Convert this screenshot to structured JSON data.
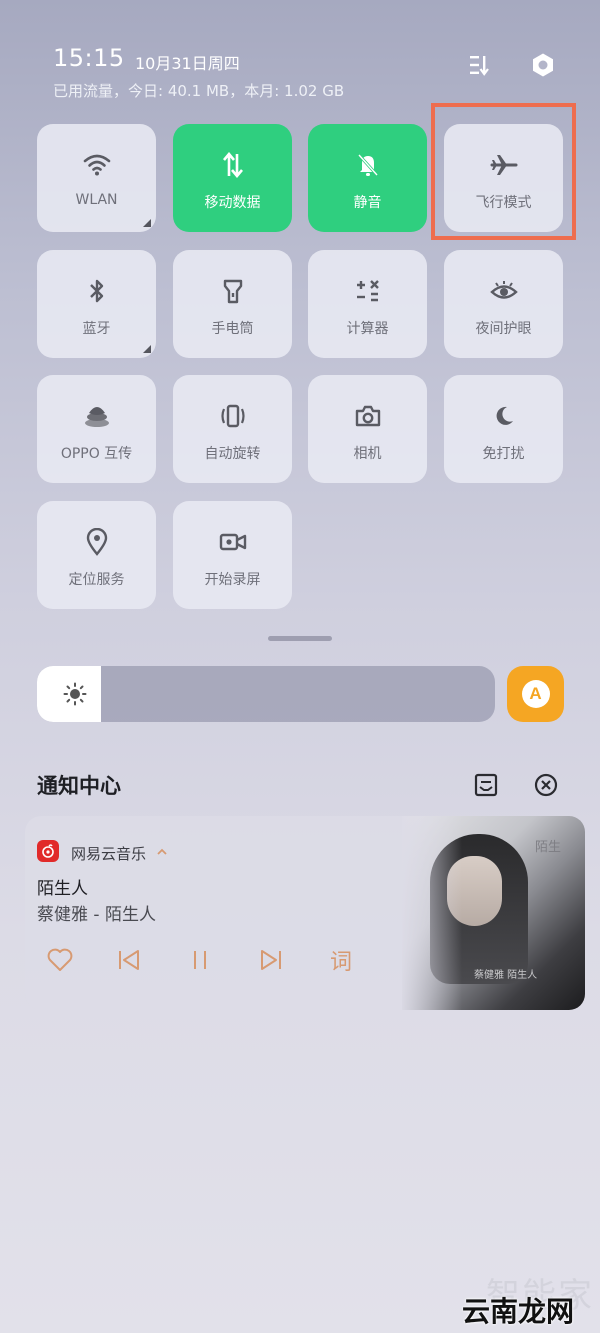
{
  "status": {
    "time": "15:15",
    "date": "10月31日周四",
    "data_usage": "已用流量，今日: 40.1 MB，本月: 1.02 GB"
  },
  "tiles": [
    {
      "label": "WLAN",
      "icon": "wifi-icon",
      "active": false
    },
    {
      "label": "移动数据",
      "icon": "mobile-data-icon",
      "active": true
    },
    {
      "label": "静音",
      "icon": "silent-bell-icon",
      "active": true
    },
    {
      "label": "飞行模式",
      "icon": "airplane-icon",
      "active": false
    },
    {
      "label": "蓝牙",
      "icon": "bluetooth-icon",
      "active": false
    },
    {
      "label": "手电筒",
      "icon": "flashlight-icon",
      "active": false
    },
    {
      "label": "计算器",
      "icon": "calculator-icon",
      "active": false
    },
    {
      "label": "夜间护眼",
      "icon": "eye-icon",
      "active": false
    },
    {
      "label": "OPPO 互传",
      "icon": "oppo-share-icon",
      "active": false
    },
    {
      "label": "自动旋转",
      "icon": "auto-rotate-icon",
      "active": false
    },
    {
      "label": "相机",
      "icon": "camera-icon",
      "active": false
    },
    {
      "label": "免打扰",
      "icon": "moon-icon",
      "active": false
    },
    {
      "label": "定位服务",
      "icon": "location-icon",
      "active": false
    },
    {
      "label": "开始录屏",
      "icon": "screen-record-icon",
      "active": false
    }
  ],
  "brightness": {
    "level": 0.14
  },
  "auto_brightness": {
    "label": "A"
  },
  "notifications": {
    "title": "通知中心"
  },
  "music": {
    "app_name": "网易云音乐",
    "song": "陌生人",
    "artist": "蔡健雅 - 陌生人",
    "lyrics_label": "词",
    "album_title": "陌生",
    "album_subtitle": "蔡健雅 陌生人"
  },
  "watermark": {
    "line1": "智能家",
    "line2": "云南龙网"
  },
  "colors": {
    "active_tile": "#2fcf7f",
    "highlight": "#ee6d4e",
    "auto_button": "#f5a623",
    "music_controls": "#d79a72"
  }
}
